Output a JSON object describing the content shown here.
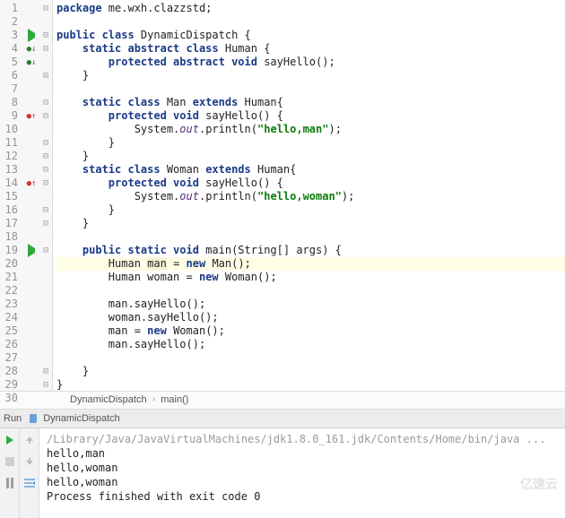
{
  "editor": {
    "filename": "DynamicDispatch",
    "breadcrumb": [
      "DynamicDispatch",
      "main()"
    ],
    "lines": [
      {
        "n": 1,
        "fold": "-",
        "html": "<span class='kw'>package</span> me.wxh.clazzstd;"
      },
      {
        "n": 2,
        "html": ""
      },
      {
        "n": 3,
        "marker": "play",
        "fold": "-",
        "html": "<span class='kw'>public class</span> DynamicDispatch {"
      },
      {
        "n": 4,
        "marker": "impl",
        "fold": "-",
        "html": "    <span class='kw'>static abstract class</span> Human {"
      },
      {
        "n": 5,
        "marker": "impl",
        "html": "        <span class='kw'>protected abstract void</span> sayHello();"
      },
      {
        "n": 6,
        "fold": "-",
        "html": "    }"
      },
      {
        "n": 7,
        "html": ""
      },
      {
        "n": 8,
        "fold": "-",
        "html": "    <span class='kw'>static class</span> Man <span class='kw'>extends</span> Human{"
      },
      {
        "n": 9,
        "marker": "over",
        "fold": "-",
        "html": "        <span class='kw'>protected void</span> sayHello() {"
      },
      {
        "n": 10,
        "html": "            System.<span class='static-it'>out</span>.println(<span class='str'>\"hello,man\"</span>);"
      },
      {
        "n": 11,
        "fold": "-",
        "html": "        }"
      },
      {
        "n": 12,
        "fold": "-",
        "html": "    }"
      },
      {
        "n": 13,
        "fold": "-",
        "html": "    <span class='kw'>static class</span> Woman <span class='kw'>extends</span> Human{"
      },
      {
        "n": 14,
        "marker": "over",
        "fold": "-",
        "html": "        <span class='kw'>protected void</span> sayHello() {"
      },
      {
        "n": 15,
        "html": "            System.<span class='static-it'>out</span>.println(<span class='str'>\"hello,woman\"</span>);"
      },
      {
        "n": 16,
        "fold": "-",
        "html": "        }"
      },
      {
        "n": 17,
        "fold": "-",
        "html": "    }"
      },
      {
        "n": 18,
        "html": ""
      },
      {
        "n": 19,
        "marker": "play",
        "fold": "-",
        "html": "    <span class='kw'>public static void</span> main(String[] args) {"
      },
      {
        "n": 20,
        "hl": true,
        "html": "        Human <span class='warn'>man</span> = <span class='kw'>new</span> Man();"
      },
      {
        "n": 21,
        "html": "        Human woman = <span class='kw'>new</span> Woman();"
      },
      {
        "n": 22,
        "html": ""
      },
      {
        "n": 23,
        "html": "        man.sayHello();"
      },
      {
        "n": 24,
        "html": "        woman.sayHello();"
      },
      {
        "n": 25,
        "html": "        man = <span class='kw'>new</span> Woman();"
      },
      {
        "n": 26,
        "html": "        man.sayHello();"
      },
      {
        "n": 27,
        "html": ""
      },
      {
        "n": 28,
        "fold": "-",
        "html": "    }"
      },
      {
        "n": 29,
        "fold": "-",
        "html": "}"
      },
      {
        "n": 30,
        "html": ""
      }
    ]
  },
  "run": {
    "tab_label": "Run",
    "config_name": "DynamicDispatch",
    "output": [
      {
        "cls": "cmd",
        "text": "/Library/Java/JavaVirtualMachines/jdk1.8.0_161.jdk/Contents/Home/bin/java ..."
      },
      {
        "cls": "",
        "text": "hello,man"
      },
      {
        "cls": "",
        "text": "hello,woman"
      },
      {
        "cls": "",
        "text": "hello,woman"
      },
      {
        "cls": "",
        "text": ""
      },
      {
        "cls": "",
        "text": "Process finished with exit code 0"
      }
    ]
  },
  "watermark": "亿速云"
}
